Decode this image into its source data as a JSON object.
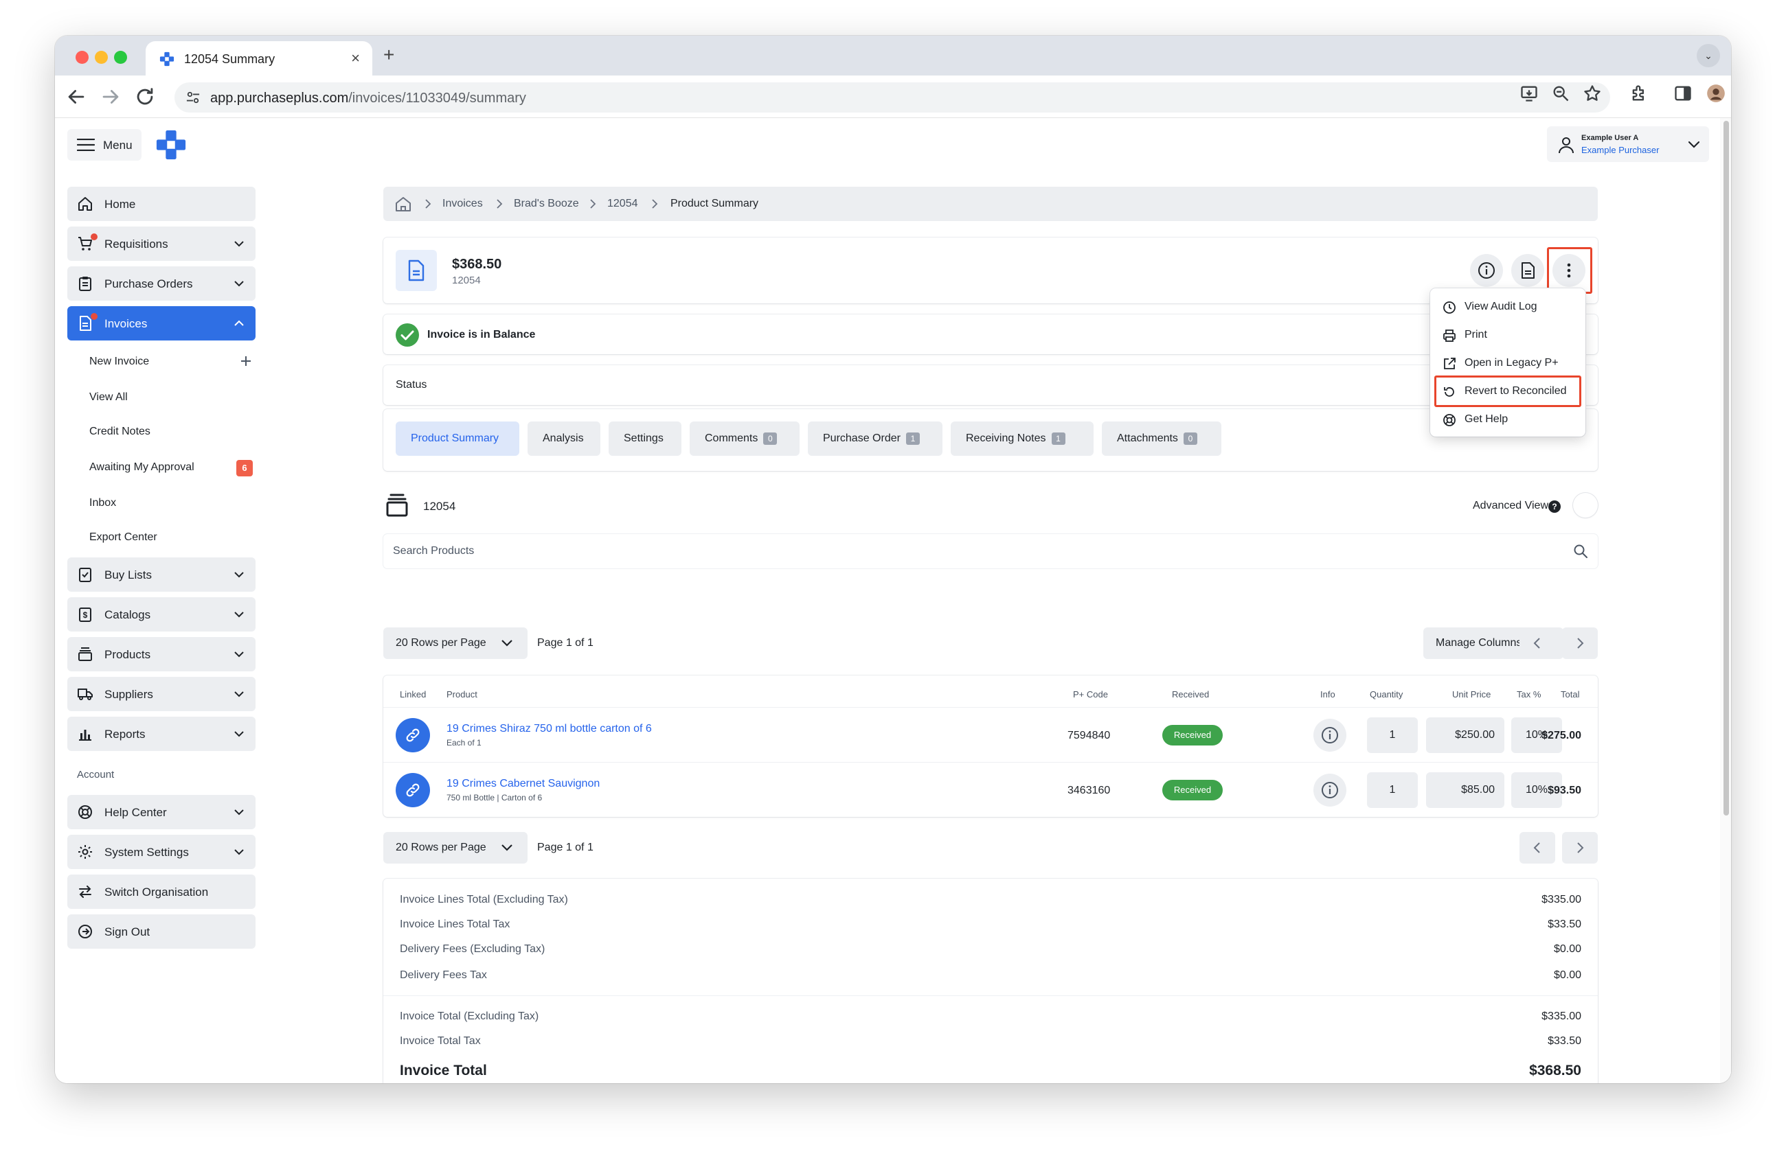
{
  "browser": {
    "tab_title": "12054 Summary",
    "url_host": "app.purchaseplus.com",
    "url_path": "/invoices/11033049/summary"
  },
  "header": {
    "menu_label": "Menu",
    "user_name": "Example User A",
    "user_role": "Example Purchaser"
  },
  "sidebar": {
    "home": "Home",
    "requisitions": "Requisitions",
    "purchase_orders": "Purchase Orders",
    "invoices": "Invoices",
    "sub": {
      "new_invoice": "New Invoice",
      "view_all": "View All",
      "credit_notes": "Credit Notes",
      "awaiting": "Awaiting My Approval",
      "awaiting_count": "6",
      "inbox": "Inbox",
      "export_center": "Export Center"
    },
    "buy_lists": "Buy Lists",
    "catalogs": "Catalogs",
    "products": "Products",
    "suppliers": "Suppliers",
    "reports": "Reports",
    "account_heading": "Account",
    "help_center": "Help Center",
    "system_settings": "System Settings",
    "switch_org": "Switch Organisation",
    "sign_out": "Sign Out"
  },
  "breadcrumb": {
    "items": [
      "Invoices",
      "Brad's Booze",
      "12054",
      "Product Summary"
    ]
  },
  "invoice": {
    "amount": "$368.50",
    "number": "12054",
    "balance_text": "Invoice is in Balance",
    "status_label": "Status"
  },
  "dropdown": {
    "items": [
      "View Audit Log",
      "Print",
      "Open in Legacy P+",
      "Revert to Reconciled",
      "Get Help"
    ]
  },
  "tabs": [
    {
      "label": "Product Summary"
    },
    {
      "label": "Analysis"
    },
    {
      "label": "Settings"
    },
    {
      "label": "Comments",
      "count": "0"
    },
    {
      "label": "Purchase Order",
      "count": "1"
    },
    {
      "label": "Receiving Notes",
      "count": "1"
    },
    {
      "label": "Attachments",
      "count": "0"
    }
  ],
  "products_section": {
    "invoice_number": "12054",
    "advanced_view": "Advanced View",
    "search_placeholder": "Search Products",
    "rows_per_page": "20 Rows per Page",
    "page_of": "Page 1 of 1",
    "manage_columns": "Manage Columns"
  },
  "table": {
    "headers": [
      "Linked",
      "Product",
      "P+ Code",
      "Received",
      "Info",
      "Quantity",
      "Unit Price",
      "Tax %",
      "Total"
    ],
    "rows": [
      {
        "name": "19 Crimes Shiraz 750 ml bottle carton of 6",
        "sub": "Each of 1",
        "code": "7594840",
        "received": "Received",
        "qty": "1",
        "unit_price": "$250.00",
        "tax": "10%",
        "total": "$275.00"
      },
      {
        "name": "19 Crimes Cabernet Sauvignon",
        "sub": "750 ml Bottle | Carton of 6",
        "code": "3463160",
        "received": "Received",
        "qty": "1",
        "unit_price": "$85.00",
        "tax": "10%",
        "total": "$93.50"
      }
    ]
  },
  "totals": {
    "lines": [
      {
        "label": "Invoice Lines Total (Excluding Tax)",
        "value": "$335.00"
      },
      {
        "label": "Invoice Lines Total Tax",
        "value": "$33.50"
      },
      {
        "label": "Delivery Fees (Excluding Tax)",
        "value": "$0.00"
      },
      {
        "label": "Delivery Fees Tax",
        "value": "$0.00"
      },
      {
        "label": "Invoice Total (Excluding Tax)",
        "value": "$335.00"
      },
      {
        "label": "Invoice Total Tax",
        "value": "$33.50"
      }
    ],
    "grand_label": "Invoice Total",
    "grand_value": "$368.50"
  },
  "colors": {
    "accent": "#2f6fe4",
    "highlight": "#e8452c",
    "received": "#3ea34b",
    "badge": "#f0604a"
  }
}
